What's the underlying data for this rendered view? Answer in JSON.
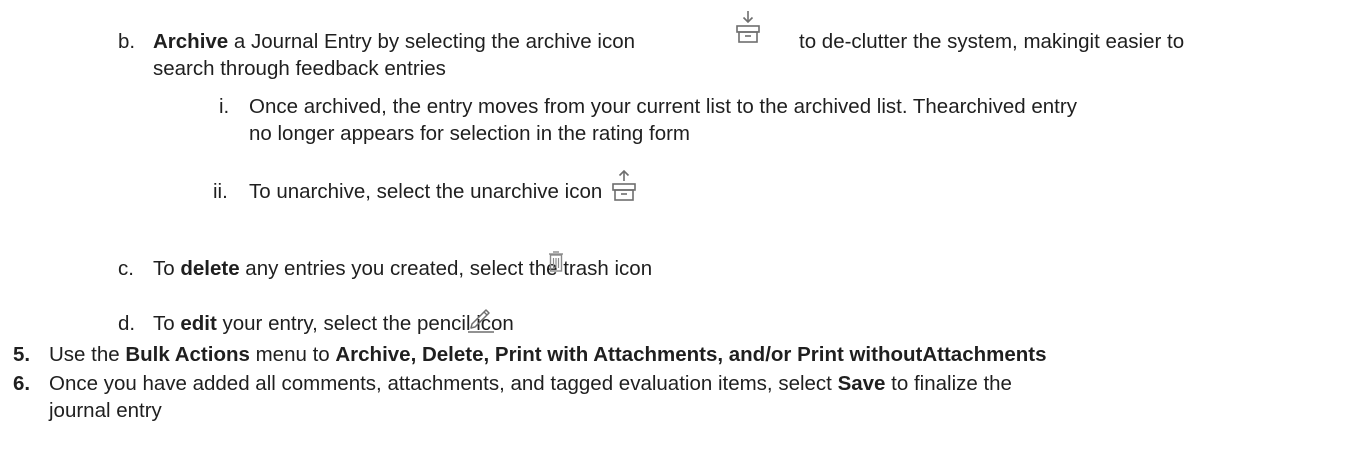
{
  "item_b": {
    "marker": "b.",
    "bold": "Archive",
    "text1": " a Journal Entry by selecting the archive icon",
    "text2": "to de-clutter the system, makingit easier to",
    "text3": "search through feedback entries",
    "icon": "archive-icon"
  },
  "item_b_i": {
    "marker": "i.",
    "text1": "Once archived, the entry moves from your current list to the archived list. Thearchived entry",
    "text2": "no longer appears for selection in the rating form"
  },
  "item_b_ii": {
    "marker": "ii.",
    "text": "To unarchive, select the unarchive icon",
    "icon": "unarchive-icon"
  },
  "item_c": {
    "marker": "c.",
    "pre": "To ",
    "bold": "delete",
    "post": " any entries you created, select the trash icon",
    "icon": "trash-icon"
  },
  "item_d": {
    "marker": "d.",
    "pre": "To ",
    "bold": "edit",
    "post": " your entry, select the pencil icon",
    "icon": "pencil-icon"
  },
  "item_5": {
    "marker": "5.",
    "pre": "Use the ",
    "bold1": "Bulk Actions",
    "mid": " menu to ",
    "bold2": "Archive, Delete, Print with Attachments, and/or Print withoutAttachments"
  },
  "item_6": {
    "marker": "6.",
    "pre": "Once you have added all comments, attachments, and tagged evaluation items, select ",
    "bold": "Save",
    "post": " to finalize the",
    "text2": "journal entry"
  },
  "colors": {
    "text": "#1f1f1f",
    "icon_stroke": "#6e6e6e"
  }
}
